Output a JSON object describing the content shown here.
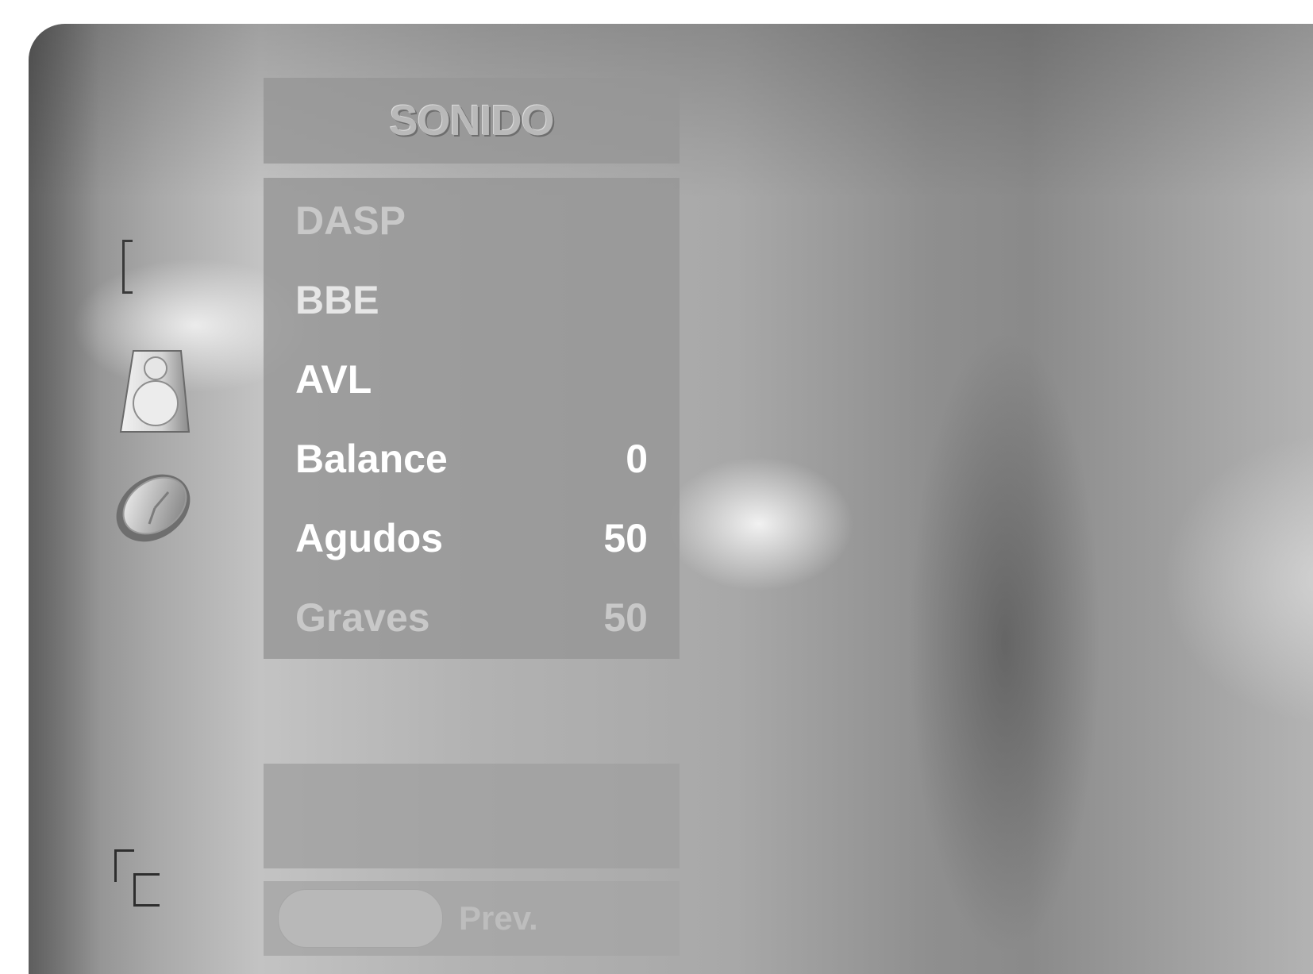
{
  "menu": {
    "title": "SONIDO",
    "items": [
      {
        "label": "DASP",
        "value": ""
      },
      {
        "label": "BBE",
        "value": ""
      },
      {
        "label": "AVL",
        "value": ""
      },
      {
        "label": "Balance",
        "value": "0"
      },
      {
        "label": "Agudos",
        "value": "50"
      },
      {
        "label": "Graves",
        "value": "50"
      }
    ]
  },
  "footer": {
    "prev_label": "Prev."
  },
  "icons": {
    "menu_bracket": "bracket-icon",
    "sound": "speaker-icon",
    "time": "clock-icon",
    "setup": "corner-bracket-icon"
  }
}
